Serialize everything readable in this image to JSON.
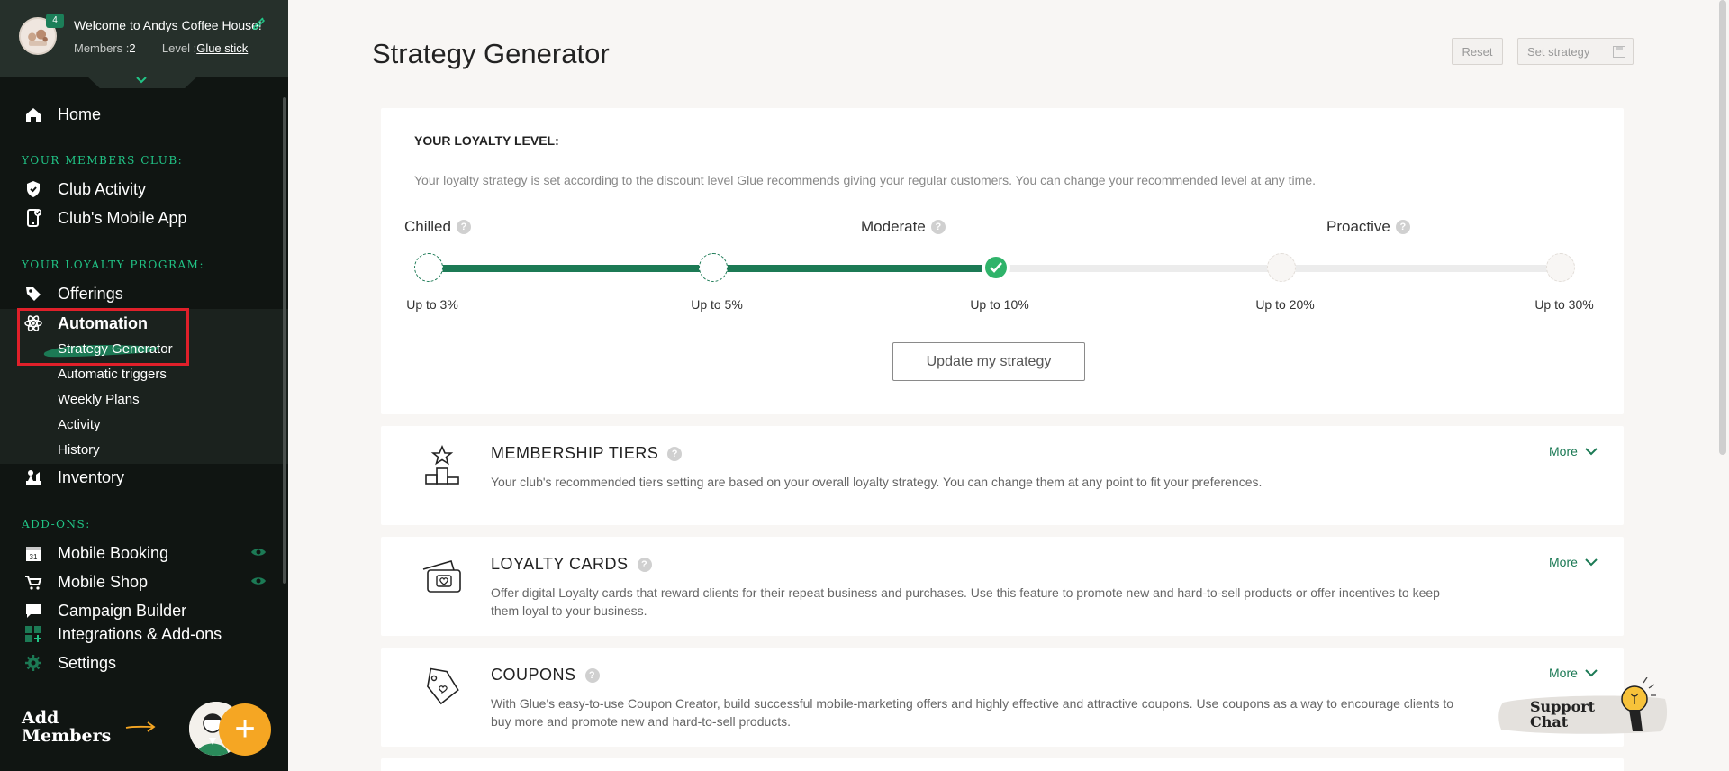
{
  "sidebar": {
    "badge_count": "4",
    "welcome": "Welcome to Andys Coffee House!",
    "members_label": "Members :",
    "members_value": "2",
    "level_label": "Level :",
    "level_value": "Glue stick",
    "home": "Home",
    "section_members_club": "YOUR MEMBERS CLUB:",
    "club_activity": "Club Activity",
    "club_mobile_app": "Club's Mobile App",
    "section_loyalty_program": "YOUR LOYALTY PROGRAM:",
    "offerings": "Offerings",
    "automation": "Automation",
    "automation_sub": [
      "Strategy Generator",
      "Automatic triggers",
      "Weekly Plans",
      "Activity",
      "History"
    ],
    "inventory": "Inventory",
    "section_addons": "ADD-ONS:",
    "mobile_booking": "Mobile Booking",
    "calendar_day": "31",
    "mobile_shop": "Mobile Shop",
    "campaign_builder": "Campaign Builder",
    "integrations": "Integrations & Add-ons",
    "settings": "Settings",
    "add_members_line1": "Add",
    "add_members_line2": "Members",
    "plus": "+"
  },
  "main": {
    "title": "Strategy Generator",
    "reset_label": "Reset",
    "set_strategy_label": "Set strategy",
    "loyalty": {
      "title": "YOUR LOYALTY LEVEL:",
      "description": "Your loyalty strategy is set according to the discount level Glue recommends giving your regular customers. You can change your recommended level at any time.",
      "levels": [
        "Chilled",
        "Moderate",
        "Proactive"
      ],
      "question_mark": "?",
      "steps": [
        "Up to 3%",
        "Up to 5%",
        "Up to 10%",
        "Up to 20%",
        "Up to 30%"
      ],
      "selected_step": "Up to 10%",
      "update_label": "Update my strategy"
    },
    "features": [
      {
        "title": "MEMBERSHIP TIERS",
        "description": "Your club's recommended tiers setting are based on your overall loyalty strategy. You can change them at any point to fit your preferences.",
        "more": "More"
      },
      {
        "title": "LOYALTY CARDS",
        "description": "Offer digital Loyalty cards that reward clients for their repeat business and purchases. Use this feature to promote new and hard-to-sell products or offer incentives to keep them loyal to your business.",
        "more": "More"
      },
      {
        "title": "COUPONS",
        "description": "With Glue's easy-to-use Coupon Creator, build successful mobile-marketing offers and highly effective and attractive coupons. Use coupons as a way to encourage clients to buy more and promote new and hard-to-sell products.",
        "more": "More"
      }
    ]
  },
  "support": {
    "line1": "Support",
    "line2": "Chat"
  },
  "colors": {
    "sidebar_bg": "#101512",
    "sidebar_header_bg": "#26302b",
    "accent_green": "#1c7a55",
    "section_green": "#21c486",
    "highlight_red": "#e0202a",
    "plus_orange": "#f5a623",
    "page_bg": "#f8f6f4"
  }
}
